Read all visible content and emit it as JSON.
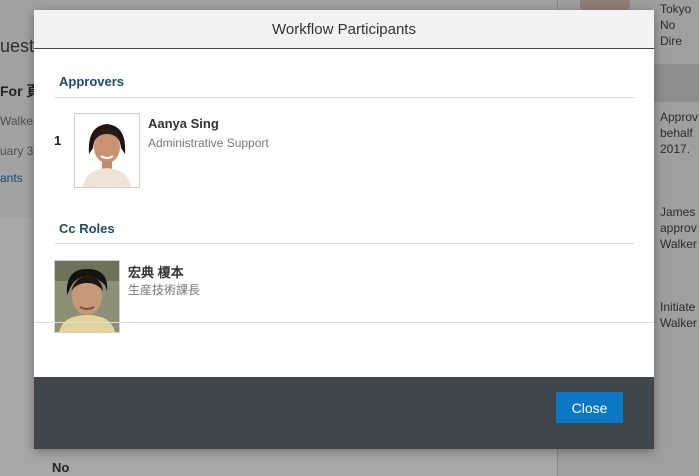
{
  "modal": {
    "title": "Workflow Participants",
    "sections": {
      "approvers": {
        "label": "Approvers",
        "entries": [
          {
            "order": "1",
            "name": "Aanya Sing",
            "role": "Administrative Support"
          }
        ]
      },
      "cc_roles": {
        "label": "Cc Roles",
        "entries": [
          {
            "name": "宏典 榎本",
            "role": "生産技術課長"
          }
        ]
      }
    },
    "close_label": "Close"
  },
  "background": {
    "heading_fragment": "uest",
    "for_fragment": "For 頁",
    "name_fragment": "Walke",
    "date_fragment": "uary 3",
    "link_fragment": "ants",
    "bottom_fragment": "No",
    "right_panel": {
      "top": "Tokyo\nNo Dire",
      "approval_note": "Approv\nbehalf\n2017.",
      "james_note": "James\napprov\nWalker",
      "initiated_note": "Initiate\nWalker"
    }
  }
}
